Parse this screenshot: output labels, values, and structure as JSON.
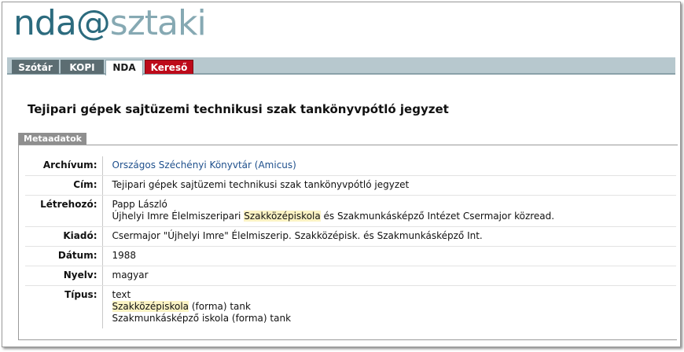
{
  "logo": {
    "part1": "nda@",
    "part2": "sztaki"
  },
  "tabs": [
    {
      "label": "Szótár"
    },
    {
      "label": "KOPI"
    },
    {
      "label": "NDA"
    },
    {
      "label": "Kereső"
    }
  ],
  "page_title": "Tejipari gépek sajtüzemi technikusi szak tankönyvpótló jegyzet",
  "metadata_section": {
    "label": "Metaadatok",
    "rows": {
      "archivum": {
        "key": "Archívum:",
        "value": "Országos Széchényi Könyvtár (Amicus)"
      },
      "cim": {
        "key": "Cím:",
        "value": "Tejipari gépek sajtüzemi technikusi szak tankönyvpótló jegyzet"
      },
      "letrehozo": {
        "key": "Létrehozó:",
        "line1": "Papp László",
        "line2_pre": "Újhelyi Imre Élelmiszeripari ",
        "line2_hl": "Szakközépiskola",
        "line2_post": " és Szakmunkásképző Intézet Csermajor közread."
      },
      "kiado": {
        "key": "Kiadó:",
        "value": "Csermajor \"Újhelyi Imre\" Élelmiszerip. Szakközépisk. és Szakmunkásképző Int."
      },
      "datum": {
        "key": "Dátum:",
        "value": "1988"
      },
      "nyelv": {
        "key": "Nyelv:",
        "value": "magyar"
      },
      "tipus": {
        "key": "Típus:",
        "line1": "text",
        "line2_hl": "Szakközépiskola",
        "line2_post": " (forma) tank",
        "line3": "Szakmunkásképző iskola (forma) tank"
      }
    }
  }
}
